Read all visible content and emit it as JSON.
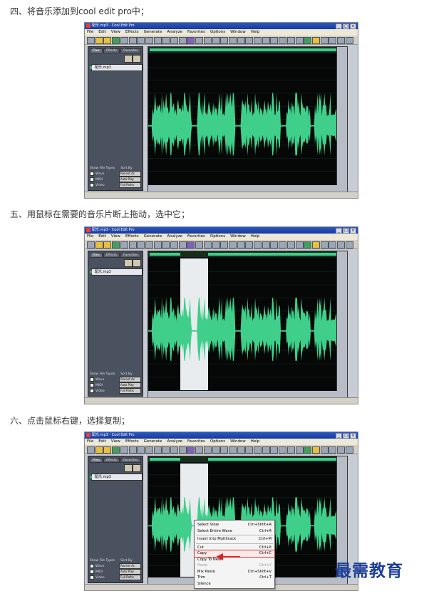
{
  "steps": [
    {
      "text": "四、将音乐添加到cool edit pro中；"
    },
    {
      "text": "五、用鼠标在需要的音乐片断上拖动，选中它；"
    },
    {
      "text": "六、点击鼠标右键，选择复制；"
    }
  ],
  "screenshots": [
    {
      "title": "配乐.mp3 - Cool Edit Pro",
      "file": "配乐.mp3"
    },
    {
      "title": "配乐.mp3 - Cool Edit Pro",
      "file": "配乐.mp3"
    },
    {
      "title": "配乐.mp3 - Cool Edit Pro",
      "file": "配乐.mp3"
    }
  ],
  "menu": [
    "File",
    "Edit",
    "View",
    "Effects",
    "Generate",
    "Analyze",
    "Favorites",
    "Options",
    "Window",
    "Help"
  ],
  "panel_tabs": [
    "Files",
    "Effects",
    "Favorites"
  ],
  "panel_footer": {
    "show_label": "Show File Types",
    "sort_label": "Sort By",
    "types": [
      "Wave",
      "MIDI",
      "Video"
    ],
    "sort_value": "Recent Ac",
    "btn1": "Auto Play",
    "btn2": "Full Paths"
  },
  "context_menu": [
    {
      "label": "Select View",
      "shortcut": "Ctrl+Shift+A",
      "state": "normal"
    },
    {
      "label": "Select Entire Wave",
      "shortcut": "Ctrl+A",
      "state": "normal"
    },
    {
      "sep": true
    },
    {
      "label": "Insert Into Multitrack",
      "shortcut": "Ctrl+M",
      "state": "normal"
    },
    {
      "sep": true
    },
    {
      "label": "Cut",
      "shortcut": "Ctrl+X",
      "state": "normal"
    },
    {
      "label": "Copy",
      "shortcut": "Ctrl+C",
      "state": "highlight"
    },
    {
      "label": "Copy To New",
      "shortcut": "",
      "state": "normal"
    },
    {
      "label": "Paste",
      "shortcut": "Ctrl+V",
      "state": "dim"
    },
    {
      "label": "Mix Paste",
      "shortcut": "Ctrl+Shift+V",
      "state": "normal"
    },
    {
      "label": "Trim",
      "shortcut": "Ctrl+T",
      "state": "normal"
    },
    {
      "label": "Silence",
      "shortcut": "",
      "state": "normal"
    }
  ],
  "watermark": "最需教育",
  "colors": {
    "wave": "#3fcf8a",
    "selection": "#e9ecef",
    "titlebar": "#1f4bb0"
  }
}
